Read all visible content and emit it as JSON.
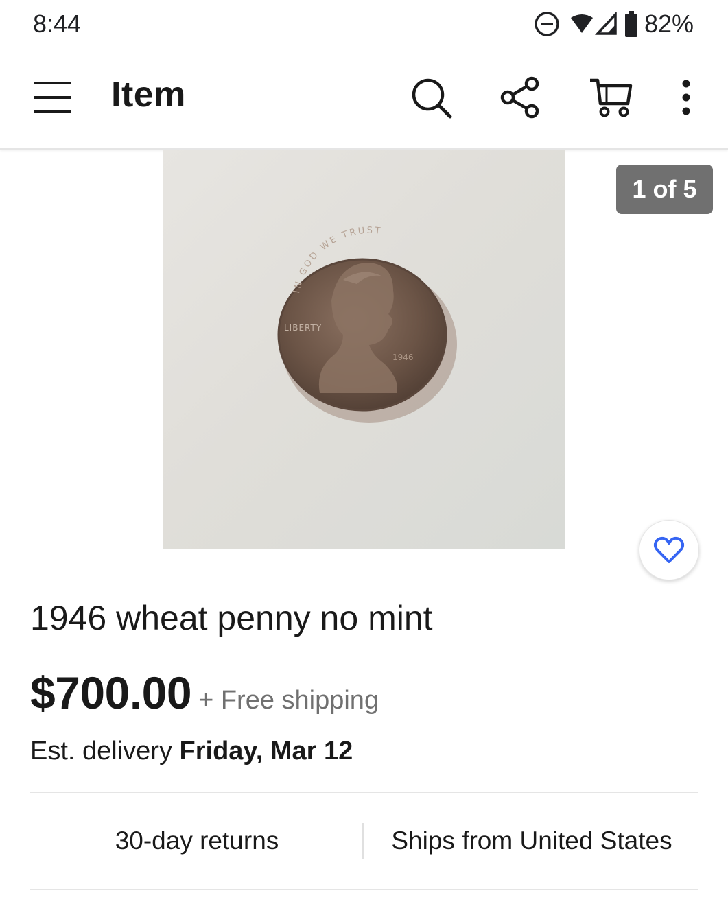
{
  "status_bar": {
    "time": "8:44",
    "battery": "82%"
  },
  "header": {
    "title": "Item"
  },
  "gallery": {
    "counter": "1 of 5"
  },
  "item": {
    "title": "1946 wheat penny no mint",
    "price": "$700.00",
    "shipping": "+ Free shipping",
    "delivery_prefix": "Est. delivery",
    "delivery_date": "Friday, Mar 12"
  },
  "features": {
    "returns": "30-day returns",
    "ships_from": "Ships from United States"
  },
  "coin": {
    "motto": "IN GOD WE TRUST",
    "liberty": "LIBERTY",
    "year": "1946"
  },
  "colors": {
    "accent": "#3665f3",
    "text": "#191919",
    "muted": "#707070"
  }
}
